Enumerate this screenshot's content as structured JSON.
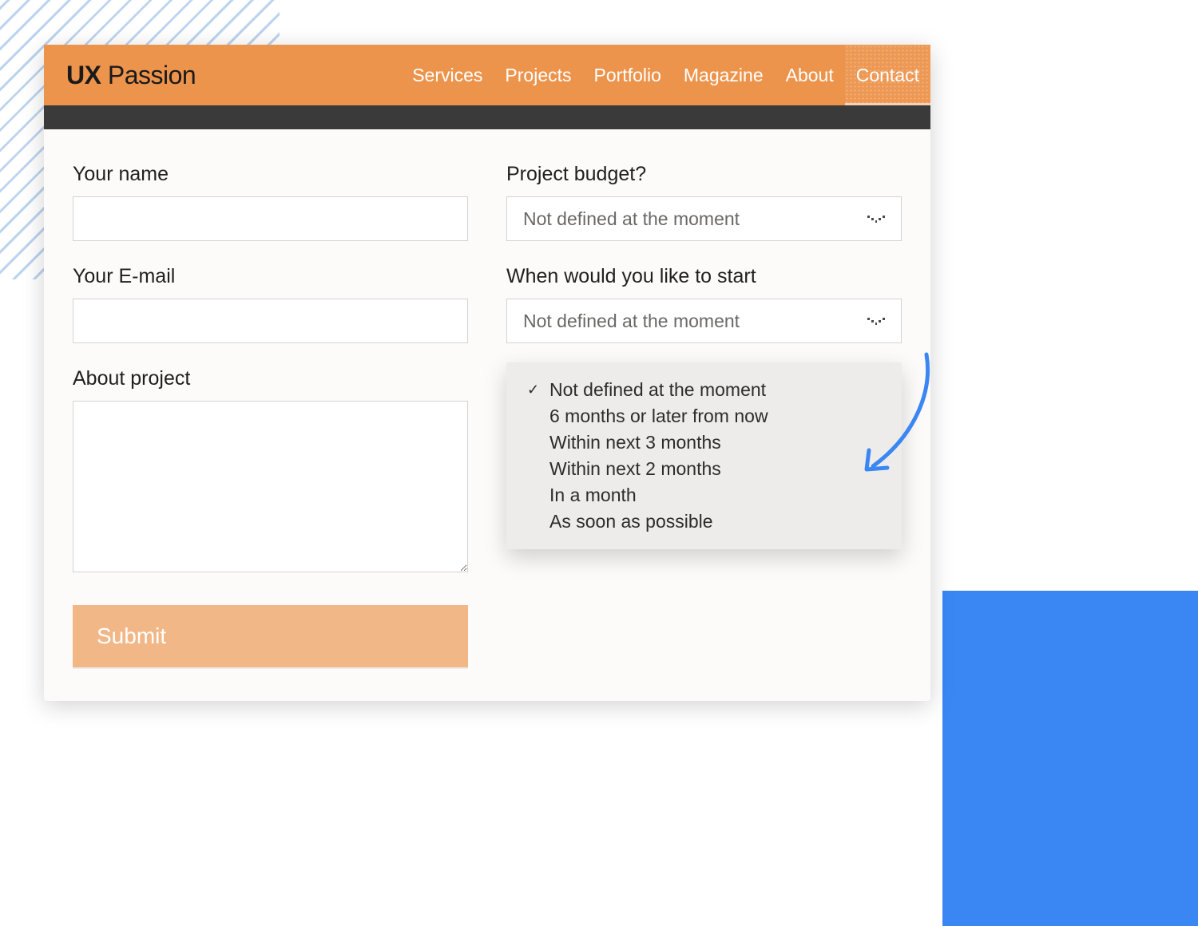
{
  "brand": {
    "bold": "UX",
    "light": " Passion"
  },
  "nav": {
    "items": [
      "Services",
      "Projects",
      "Portfolio",
      "Magazine",
      "About",
      "Contact"
    ],
    "active_index": 5
  },
  "form": {
    "name": {
      "label": "Your name",
      "value": ""
    },
    "email": {
      "label": "Your E-mail",
      "value": ""
    },
    "about": {
      "label": "About project",
      "value": ""
    },
    "budget": {
      "label": "Project budget?",
      "selected": "Not defined at the moment"
    },
    "start": {
      "label": "When would you like to start",
      "selected": "Not defined at the moment",
      "options": [
        "Not defined at the moment",
        "6 months or later from now",
        "Within next 3 months",
        "Within next 2 months",
        "In a month",
        "As soon as possible"
      ],
      "checked_index": 0
    },
    "submit_label": "Submit"
  },
  "colors": {
    "accent": "#ed944c",
    "button": "#f1b787",
    "arrow": "#3a87f4"
  }
}
